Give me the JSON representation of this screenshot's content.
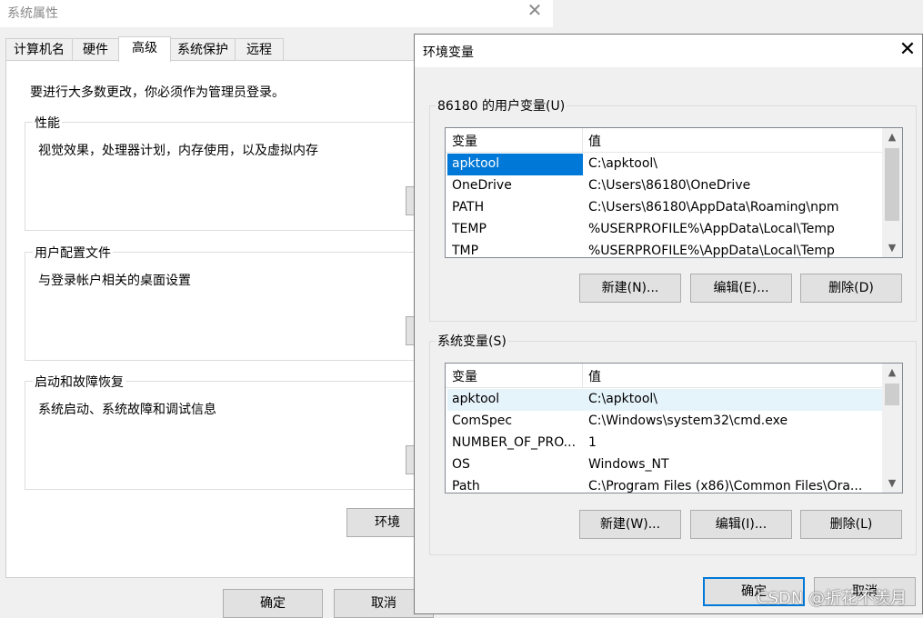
{
  "system_properties": {
    "title": "系统属性",
    "close_glyph": "✕",
    "tabs": [
      "计算机名",
      "硬件",
      "高级",
      "系统保护",
      "远程"
    ],
    "admin_note": "要进行大多数更改，你必须作为管理员登录。",
    "groups": [
      {
        "title": "性能",
        "description": "视觉效果，处理器计划，内存使用，以及虚拟内存"
      },
      {
        "title": "用户配置文件",
        "description": "与登录帐户相关的桌面设置"
      },
      {
        "title": "启动和故障恢复",
        "description": "系统启动、系统故障和调试信息"
      }
    ],
    "env_button_label": "环境",
    "ok_label": "确定",
    "cancel_label": "取消"
  },
  "env_dialog": {
    "title": "环境变量",
    "close_glyph": "✕",
    "user_group_title": "86180 的用户变量(U)",
    "system_group_title": "系统变量(S)",
    "col_variable": "变量",
    "col_value": "值",
    "user_vars": [
      {
        "name": "apktool",
        "value": "C:\\apktool\\"
      },
      {
        "name": "OneDrive",
        "value": "C:\\Users\\86180\\OneDrive"
      },
      {
        "name": "PATH",
        "value": "C:\\Users\\86180\\AppData\\Roaming\\npm"
      },
      {
        "name": "TEMP",
        "value": "%USERPROFILE%\\AppData\\Local\\Temp"
      },
      {
        "name": "TMP",
        "value": "%USERPROFILE%\\AppData\\Local\\Temp"
      }
    ],
    "system_vars": [
      {
        "name": "apktool",
        "value": "C:\\apktool\\"
      },
      {
        "name": "ComSpec",
        "value": "C:\\Windows\\system32\\cmd.exe"
      },
      {
        "name": "NUMBER_OF_PRO...",
        "value": "1"
      },
      {
        "name": "OS",
        "value": "Windows_NT"
      },
      {
        "name": "Path",
        "value": "C:\\Program Files (x86)\\Common Files\\Ora..."
      }
    ],
    "user_buttons": {
      "new": "新建(N)...",
      "edit": "编辑(E)...",
      "delete": "删除(D)"
    },
    "system_buttons": {
      "new": "新建(W)...",
      "edit": "编辑(I)...",
      "delete": "删除(L)"
    },
    "ok_label": "确定",
    "cancel_label": "取消"
  },
  "watermark": "CSDN @折花不羡月"
}
